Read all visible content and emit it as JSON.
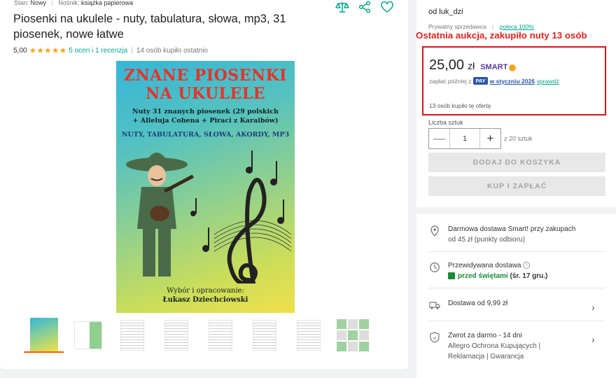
{
  "meta": {
    "condition_label": "Stan:",
    "condition_value": "Nowy",
    "medium_label": "Nośnik:",
    "medium_value": "książka papierowa"
  },
  "product": {
    "title": "Piosenki na ukulele - nuty, tabulatura, słowa, mp3, 31 piosenek, nowe łatwe",
    "rating_score": "5,00",
    "stars": "★★★★★",
    "rating_link": "5 ocen i 1 recenzja",
    "recent_buyers": "14 osób kupiło ostatnio"
  },
  "cover": {
    "title_line1": "ZNANE PIOSENKI",
    "title_line2": "NA UKULELE",
    "subtitle_line1": "Nuty 31 znanych piosenek (29 polskich",
    "subtitle_line2": "+ Alleluja Cohena + Piraci z Karaibów)",
    "tagline": "NUTY, TABULATURA, SŁOWA, AKORDY, MP3",
    "by_line1": "Wybór i opracowanie:",
    "by_line2": "Łukasz Dziechciowski"
  },
  "seller": {
    "name": "od luk_dzi",
    "type": "Prywatny sprzedawca",
    "recommend": "poleca 100%"
  },
  "annotation": "Ostatnia aukcja, zakupiło nuty 13 osób",
  "offer": {
    "price": "25,00",
    "currency": "zł",
    "smart_label": "SMART",
    "pay_later_prefix": "zapłać później z",
    "pay_badge": "PAY",
    "pay_month": "w styczniu 2026",
    "pay_check": "sprawdź",
    "bought_count": "13 osób kupiło tę ofertę"
  },
  "quantity": {
    "label": "Liczba sztuk",
    "value": "1",
    "minus": "—",
    "plus": "+",
    "of_total": "z 20 sztuk"
  },
  "buttons": {
    "add_to_cart": "DODAJ DO KOSZYKA",
    "buy_now": "KUP I ZAPŁAĆ"
  },
  "delivery": {
    "free_line1": "Darmowa dostawa Smart! przy zakupach",
    "free_line2": "od 45 zł (punkty odbioru)",
    "expected_label": "Przewidywana dostawa",
    "expected_value": "przed świętami",
    "expected_date": "(śr. 17 gru.)",
    "shipping": "Dostawa od 9,99 zł",
    "returns_line1": "Zwrot za darmo - 14 dni",
    "returns_line2": "Allegro Ochrona Kupujących  |",
    "returns_line3": "Reklamacja  |  Gwarancja"
  },
  "colors": {
    "accent": "#00a790",
    "star": "#f5a623",
    "annotation": "#e0231d",
    "highlight_border": "#d6151d",
    "smart": "#5a3aa8"
  }
}
